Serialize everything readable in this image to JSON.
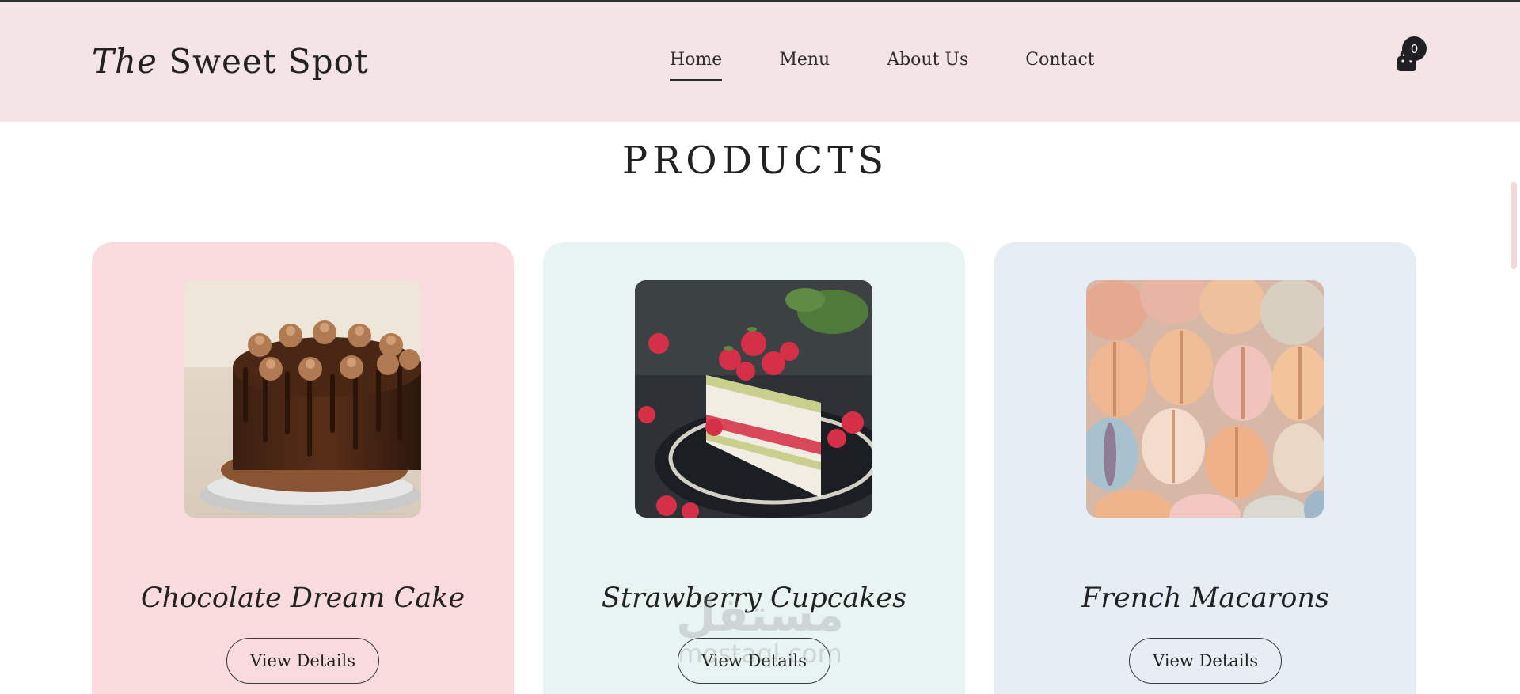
{
  "header": {
    "logo_italic": "The",
    "logo_rest": " Sweet Spot",
    "nav": [
      {
        "label": "Home",
        "active": true
      },
      {
        "label": "Menu",
        "active": false
      },
      {
        "label": "About Us",
        "active": false
      },
      {
        "label": "Contact",
        "active": false
      }
    ],
    "cart": {
      "icon": "shopping-bag-icon",
      "count": "0"
    }
  },
  "products": {
    "title": "PRODUCTS",
    "items": [
      {
        "name": "Chocolate Dream Cake",
        "button": "View Details",
        "image": "chocolate-cake-photo",
        "bg": "#f9dbde"
      },
      {
        "name": "Strawberry Cupcakes",
        "button": "View Details",
        "image": "raspberry-cake-slice-photo",
        "bg": "#e8f4f1"
      },
      {
        "name": "French Macarons",
        "button": "View Details",
        "image": "macarons-photo",
        "bg": "#e6edf5"
      }
    ]
  },
  "watermark": {
    "arabic": "مستقل",
    "latin": "mostaql.com"
  },
  "colors": {
    "header_bg": "#f5e4e6",
    "accent_dark": "#1f1f24"
  }
}
